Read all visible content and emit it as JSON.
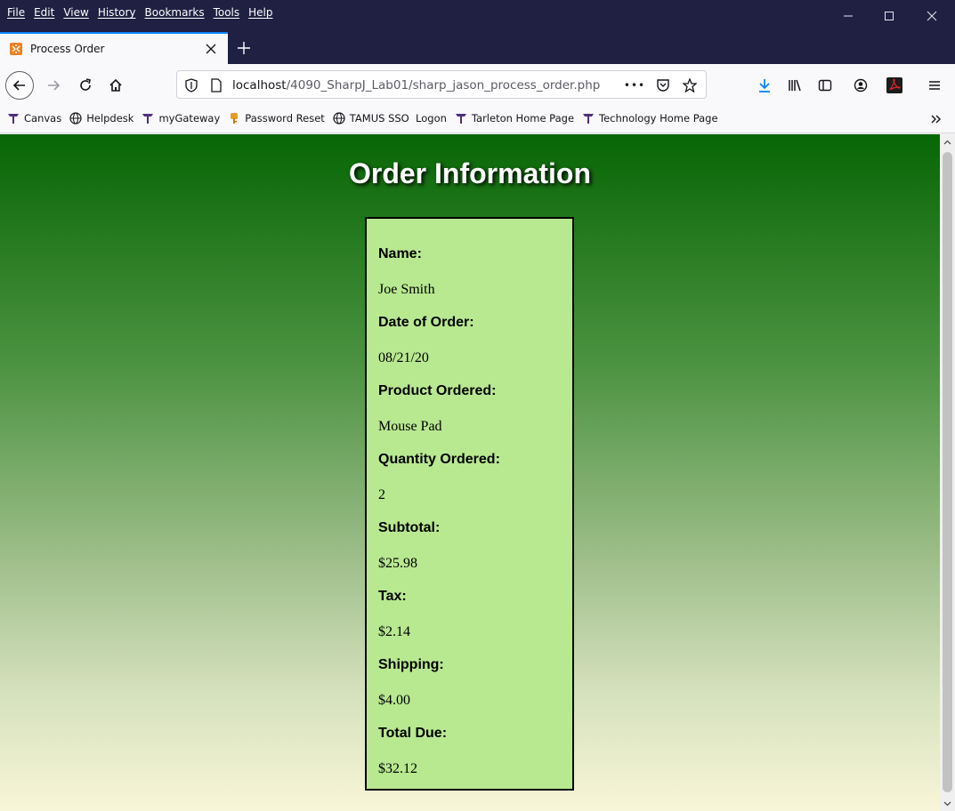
{
  "menubar": {
    "items": [
      "File",
      "Edit",
      "View",
      "History",
      "Bookmarks",
      "Tools",
      "Help"
    ]
  },
  "tab": {
    "title": "Process Order"
  },
  "url": {
    "host": "localhost",
    "path": "/4090_SharpJ_Lab01/sharp_jason_process_order.php",
    "more": "•••"
  },
  "bookmarks": [
    {
      "label": "Canvas",
      "icon": "tarleton-t-icon"
    },
    {
      "label": "Helpdesk",
      "icon": "globe-icon"
    },
    {
      "label": "myGateway",
      "icon": "tarleton-t-icon"
    },
    {
      "label": "Password Reset",
      "icon": "key-icon"
    },
    {
      "label": "TAMUS SSO  Logon",
      "icon": "globe-icon"
    },
    {
      "label": "Tarleton Home Page",
      "icon": "tarleton-t-icon"
    },
    {
      "label": "Technology Home Page",
      "icon": "tarleton-t-icon"
    }
  ],
  "page": {
    "title": "Order Information",
    "fields": [
      {
        "label": "Name:",
        "value": "Joe Smith"
      },
      {
        "label": "Date of Order:",
        "value": "08/21/20"
      },
      {
        "label": "Product Ordered:",
        "value": "Mouse Pad"
      },
      {
        "label": "Quantity Ordered:",
        "value": "2"
      },
      {
        "label": "Subtotal:",
        "value": "$25.98"
      },
      {
        "label": "Tax:",
        "value": "$2.14"
      },
      {
        "label": "Shipping:",
        "value": "$4.00"
      },
      {
        "label": "Total Due:",
        "value": "$32.12"
      }
    ]
  },
  "colors": {
    "accent": "#0a84ff",
    "titlebar": "#1f2042",
    "box_bg": "#b8e890",
    "gradient_top": "#076605",
    "gradient_bottom": "#f8f6d8"
  }
}
